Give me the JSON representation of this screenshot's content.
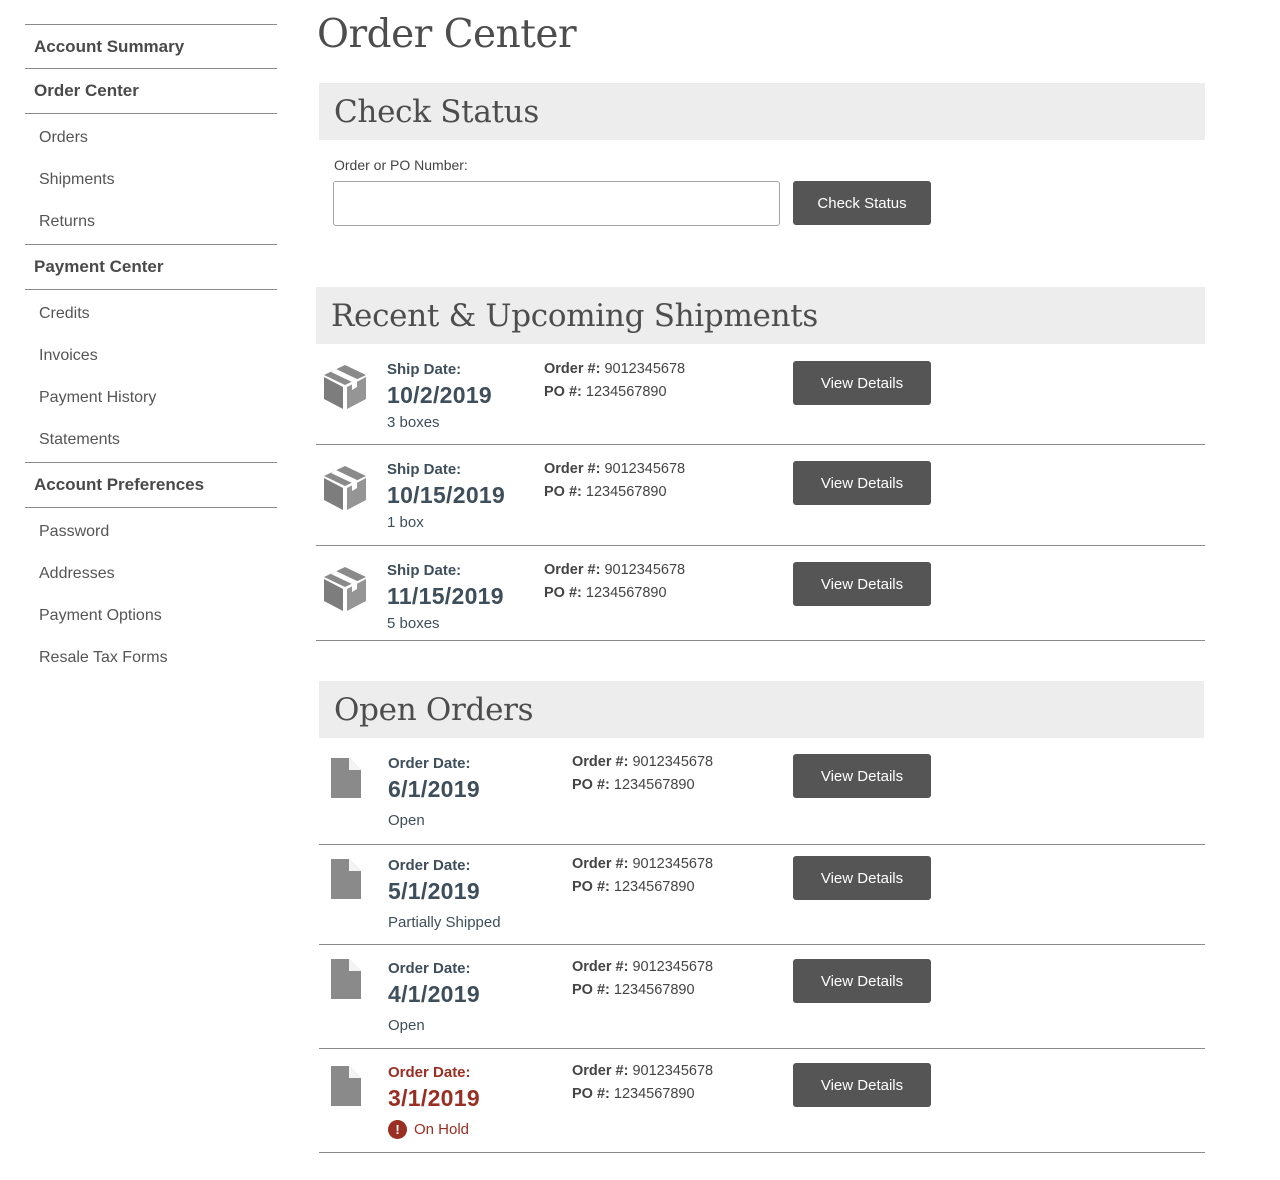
{
  "sidebar": {
    "sections": [
      {
        "label": "Account Summary",
        "items": []
      },
      {
        "label": "Order Center",
        "items": [
          "Orders",
          "Shipments",
          "Returns"
        ]
      },
      {
        "label": "Payment Center",
        "items": [
          "Credits",
          "Invoices",
          "Payment History",
          "Statements"
        ]
      },
      {
        "label": "Account Preferences",
        "items": [
          "Password",
          "Addresses",
          "Payment Options",
          "Resale Tax Forms"
        ]
      }
    ]
  },
  "page": {
    "title": "Order Center"
  },
  "check_status": {
    "header": "Check Status",
    "field_label": "Order or PO Number:",
    "input_value": "",
    "button_label": "Check Status"
  },
  "shipments": {
    "header": "Recent & Upcoming Shipments",
    "date_label": "Ship Date:",
    "order_label": "Order #:",
    "po_label": "PO #:",
    "button_label": "View Details",
    "rows": [
      {
        "date": "10/2/2019",
        "boxes": "3 boxes",
        "order": "9012345678",
        "po": "1234567890"
      },
      {
        "date": "10/15/2019",
        "boxes": "1 box",
        "order": "9012345678",
        "po": "1234567890"
      },
      {
        "date": "11/15/2019",
        "boxes": "5 boxes",
        "order": "9012345678",
        "po": "1234567890"
      }
    ]
  },
  "open_orders": {
    "header": "Open Orders",
    "date_label": "Order Date:",
    "order_label": "Order #:",
    "po_label": "PO #:",
    "button_label": "View Details",
    "rows": [
      {
        "date": "6/1/2019",
        "status": "Open",
        "order": "9012345678",
        "po": "1234567890",
        "alert": false
      },
      {
        "date": "5/1/2019",
        "status": "Partially Shipped",
        "order": "9012345678",
        "po": "1234567890",
        "alert": false
      },
      {
        "date": "4/1/2019",
        "status": "Open",
        "order": "9012345678",
        "po": "1234567890",
        "alert": false
      },
      {
        "date": "3/1/2019",
        "status": "On Hold",
        "order": "9012345678",
        "po": "1234567890",
        "alert": true
      }
    ]
  },
  "icons": {
    "shipment": "package-box-icon",
    "order": "document-icon",
    "alert": "exclamation-circle-icon"
  },
  "colors": {
    "button": "#555555",
    "header_band": "#ededed",
    "text_dark": "#3e4e5a",
    "alert": "#9a2e22"
  }
}
